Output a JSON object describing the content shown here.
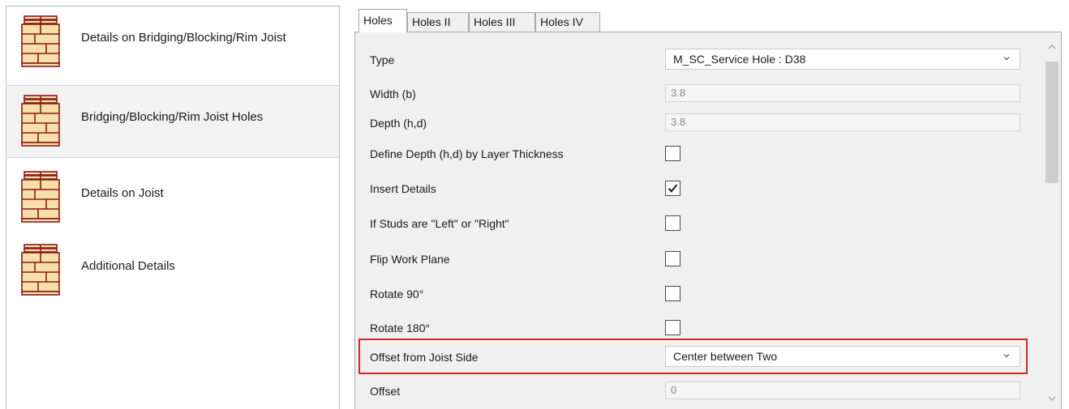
{
  "left_list": {
    "items": [
      {
        "label": "Details on Bridging/Blocking/Rim Joist",
        "icon": "frame-layout-icon",
        "selected": false
      },
      {
        "label": "Bridging/Blocking/Rim Joist Holes",
        "icon": "frame-layout-icon",
        "selected": true
      },
      {
        "label": "Details on Joist",
        "icon": "frame-layout-icon",
        "selected": false
      },
      {
        "label": "Additional Details",
        "icon": "frame-layout-icon",
        "selected": false
      }
    ]
  },
  "tabs": [
    {
      "label": "Holes",
      "active": true
    },
    {
      "label": "Holes II",
      "active": false
    },
    {
      "label": "Holes III",
      "active": false
    },
    {
      "label": "Holes IV",
      "active": false
    }
  ],
  "properties": {
    "type": {
      "label": "Type",
      "value": "M_SC_Service Hole : D38"
    },
    "width": {
      "label": "Width (b)",
      "value": "3.8"
    },
    "depth": {
      "label": "Depth (h,d)",
      "value": "3.8"
    },
    "define_depth": {
      "label": "Define Depth (h,d) by Layer Thickness",
      "checked": false
    },
    "insert_details": {
      "label": "Insert Details",
      "checked": true
    },
    "studs_left_right": {
      "label": "If Studs are \"Left\" or \"Right\"",
      "checked": false
    },
    "flip_work_plane": {
      "label": "Flip Work Plane",
      "checked": false
    },
    "rotate_90": {
      "label": "Rotate 90°",
      "checked": false
    },
    "rotate_180": {
      "label": "Rotate 180°",
      "checked": false
    },
    "offset_from_side": {
      "label": "Offset from Joist Side",
      "value": "Center between Two"
    },
    "offset": {
      "label": "Offset",
      "value": "0"
    }
  },
  "colors": {
    "highlight": "#d9262b",
    "icon_fill": "#f7dfa8",
    "icon_stroke": "#8b1a1a",
    "panel_bg": "#f0f0f0"
  }
}
